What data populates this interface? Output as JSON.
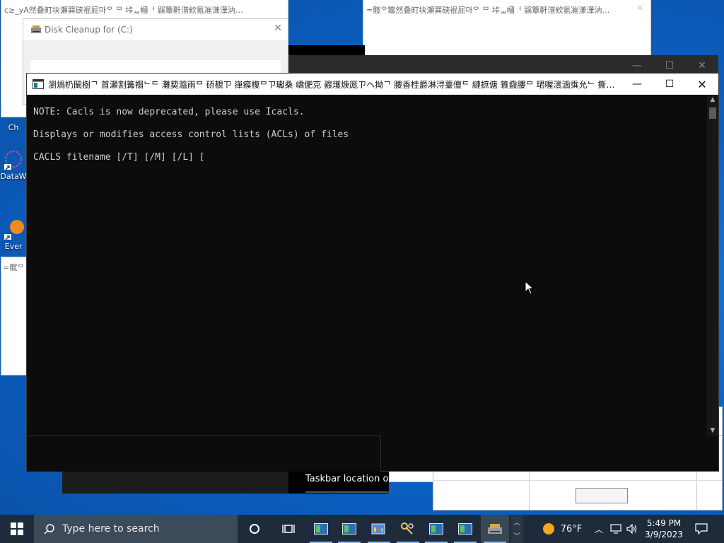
{
  "desktop": {
    "icons": [
      {
        "label": "Ch",
        "name": "desktop-icon-chrome"
      },
      {
        "label": "DataW",
        "name": "desktop-icon-datawrapper"
      },
      {
        "label": "Ever",
        "name": "desktop-icon-everything"
      }
    ]
  },
  "bg_windows": {
    "topleft_title": "c≳_yA然叠町块瀬巽硖裩屁마ᄋ ᄆ 垰ᇪ幗ᅥ 鼷簟鼾湝欸氪凗溓澕汭…",
    "topright_title": "=髋ᄋ鼈然叠町块瀬巽硖裩屁마ᄋ ᄆ 垰ᇪ幗ᅥ 鼷簟鼾湝欸氪凗溓澕汭…",
    "left_small_title": "=髋ᄋ"
  },
  "disk_cleanup": {
    "title": "Disk Cleanup for  (C:)"
  },
  "console": {
    "title": "瀏煱㭁鬫樹ᄀ 首瀬割篝禤ᄂᄃ 灘葜瀶雨ᄆ 硚覩ㄗ 嵂瘊椱ᄆㄗ瓛桑 嶠俷克 鼝瓁焿厖ㄗヘ拗ᄀ 腰香桂爵淋浔薹儃ᄃ 縺摭傏 簑鼗膢ᄆ 珺喔瀥湎霟允ᄂ 撕牡 权昹…",
    "lines": [
      "NOTE: Cacls is now deprecated, please use Icacls.",
      "Displays or modifies access control lists (ACLs) of files",
      "CACLS filename [/T] [/M] [/L] ["
    ]
  },
  "bg_overlay": {
    "taskbar_location_text": "Taskbar location on"
  },
  "taskbar": {
    "search_placeholder": "Type here to search",
    "weather_temp": "76°F",
    "time": "5:49 PM",
    "date": "3/9/2023"
  }
}
